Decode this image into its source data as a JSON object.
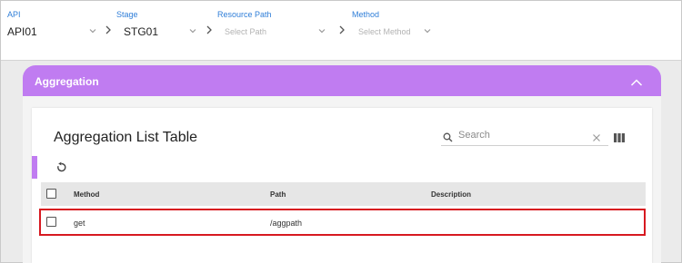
{
  "selectors": {
    "api": {
      "label": "API",
      "value": "API01"
    },
    "stage": {
      "label": "Stage",
      "value": "STG01"
    },
    "resource_path": {
      "label": "Resource Path",
      "placeholder": "Select Path"
    },
    "method": {
      "label": "Method",
      "placeholder": "Select Method"
    }
  },
  "panel": {
    "title": "Aggregation",
    "card_title": "Aggregation List Table",
    "search_placeholder": "Search"
  },
  "table": {
    "columns": [
      "Method",
      "Path",
      "Description"
    ],
    "rows": [
      {
        "method": "get",
        "path": "/aggpath",
        "description": ""
      }
    ]
  },
  "colors": {
    "accent": "#c07cf1",
    "link_label": "#2f7ed8",
    "highlight_border": "#d71920"
  }
}
